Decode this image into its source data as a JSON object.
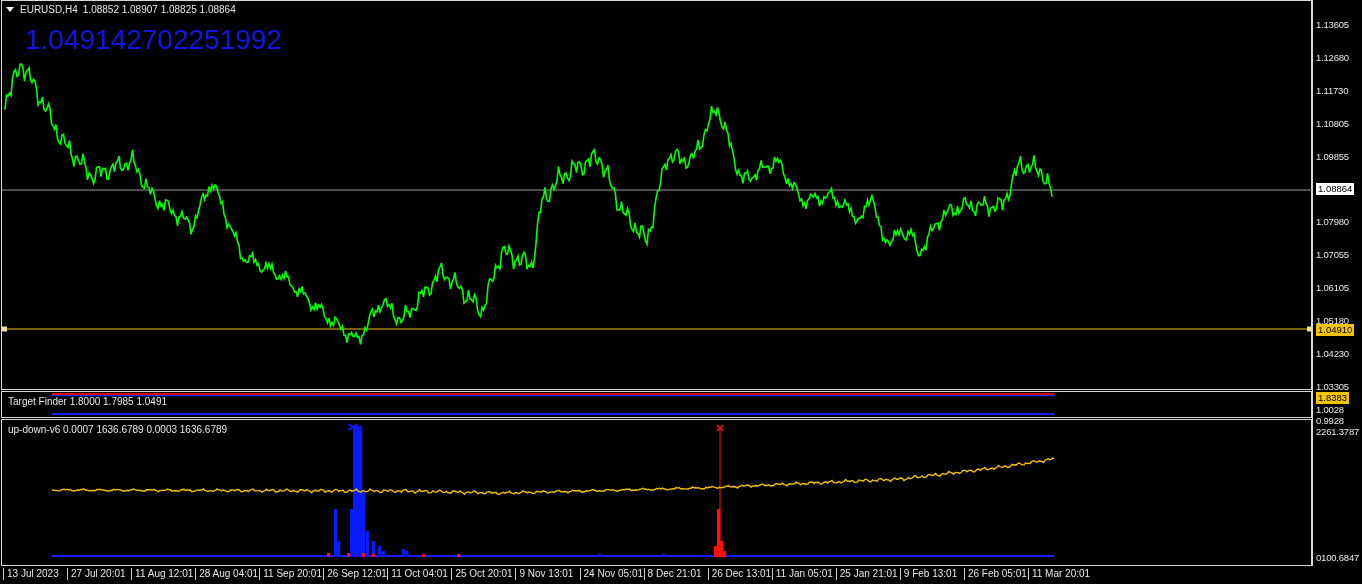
{
  "chart": {
    "symbol": "EURUSD,H4",
    "ohlc": "1.08852 1.08907 1.08825 1.08864",
    "big_value": "1.049142702251992",
    "price_axis": [
      "1.13605",
      "1.12680",
      "1.11730",
      "1.10805",
      "1.09855",
      "1.07980",
      "1.07055",
      "1.06105",
      "1.05180",
      "1.04230",
      "1.03305"
    ],
    "current_price": "1.08864",
    "level_price": "1.04910"
  },
  "indicator_1": {
    "label": "Target Finder 1.8000 1.7985 1.0491",
    "badge": "1.8383",
    "axis": [
      "1.0028",
      "0.9928"
    ]
  },
  "indicator_2": {
    "label": "up-down-v6 0.0007 1636.6789 0.0003 1636.6789",
    "axis": [
      "2261.3787",
      "0100.6847"
    ]
  },
  "time_axis": [
    "13 Jul 2023",
    "27 Jul 20:01",
    "11 Aug 12:01",
    "28 Aug 04:01",
    "11 Sep 20:01",
    "26 Sep 12:01",
    "11 Oct 04:01",
    "25 Oct 20:01",
    "9 Nov 13:01",
    "24 Nov 05:01",
    "8 Dec 21:01",
    "26 Dec 13:01",
    "11 Jan 05:01",
    "25 Jan 21:01",
    "9 Feb 13:01",
    "26 Feb 05:01",
    "11 Mar 20:01"
  ]
}
